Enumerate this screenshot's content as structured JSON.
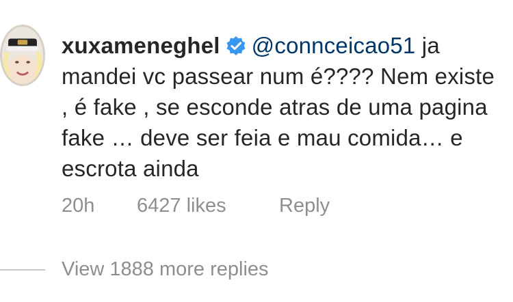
{
  "comment": {
    "avatar_icon": "user-avatar-icon",
    "username": "xuxameneghel",
    "verified_icon": "verified-badge-icon",
    "mention": "@connceicao51",
    "text": " ja mandei vc passear num é???? Nem existe , é fake , se esconde atras de uma pagina fake … deve ser feia e mau comida… e escrota ainda",
    "time": "20h",
    "likes": "6427 likes",
    "reply_label": "Reply"
  },
  "thread": {
    "view_replies_label": "View 1888 more replies"
  },
  "colors": {
    "mention": "#00376b",
    "verified": "#3897f0",
    "meta": "#8e8e8e",
    "text": "#262626"
  }
}
